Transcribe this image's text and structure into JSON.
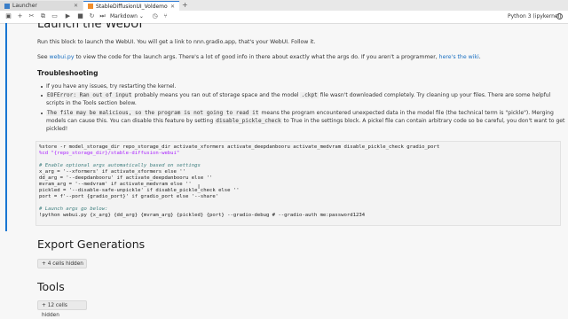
{
  "tabs": [
    {
      "label": "Launcher"
    },
    {
      "label": "StableDiffusionUI_Voldemo"
    }
  ],
  "toolbar": {
    "cell_type": "Markdown",
    "kernel": "Python 3 (ipykernel)"
  },
  "content": {
    "heading": "Launch the WebUI",
    "intro": "Run this block to launch the WebUI. You will get a link to nnn.gradio.app, that's your WebUI. Follow it.",
    "see_line_a": "See ",
    "see_link": "webui.py",
    "see_line_b": " to view the code for the launch args. There's a lot of good info in there about exactly what the args do. If you aren't a programmer, ",
    "wiki_link": "here's the wiki",
    "see_line_c": ".",
    "troubleshooting": "Troubleshooting",
    "bullets": {
      "b1": "If you have any issues, try restarting the kernel.",
      "b2_code": "EOFError: Ran out of input",
      "b2_a": " probably means you ran out of storage space and the model ",
      "b2_code2": ".ckpt",
      "b2_b": " file wasn't downloaded completely. Try cleaning up your files. There are some helpful",
      "b2_c": "scripts in the Tools section below.",
      "b3_code": "The file may be malicious, so the program is not going to read it",
      "b3_a": " means the program encountered unexpected data in the model file (the technical term is \"pickle\"). Merging",
      "b3_b": "models can cause this. You can disable this feature by setting ",
      "b3_code2": "disable_pickle_check",
      "b3_c": " to True in the settings block. A pickel file can contain arbitrary code so be careful, you don't want to get",
      "b3_d": "pickled!"
    },
    "code_lines": {
      "l1": "%store -r model_storage_dir repo_storage_dir activate_xformers activate_deepdanbooru activate_medvram disable_pickle_check gradio_port",
      "l2": "%cd \"{repo_storage_dir}/stable-diffusion-webui\"",
      "l3": "# Enable optional args automatically based on settings",
      "l4": "x_arg = '--xformers' if activate_xformers else ''",
      "l5": "dd_arg = '--deepdanbooru' if activate_deepdanbooru else ''",
      "l6": "mvram_arg = '--medvram' if activate_medvram else ''",
      "l7": "pickled = '--disable-safe-unpickle' if disable_pickle_check else ''",
      "l8": "port = f'--port {gradio_port}' if gradio_port else '--share'",
      "l9": "# Launch args go below:",
      "l10": "!python webui.py {x_arg} {dd_arg} {mvram_arg} {pickled} {port} --gradio-debug # --gradio-auth me:password1234"
    },
    "export_heading": "Export Generations",
    "export_hidden": "4 cells hidden",
    "tools_heading": "Tools",
    "tools_hidden": "12 cells hidden"
  }
}
